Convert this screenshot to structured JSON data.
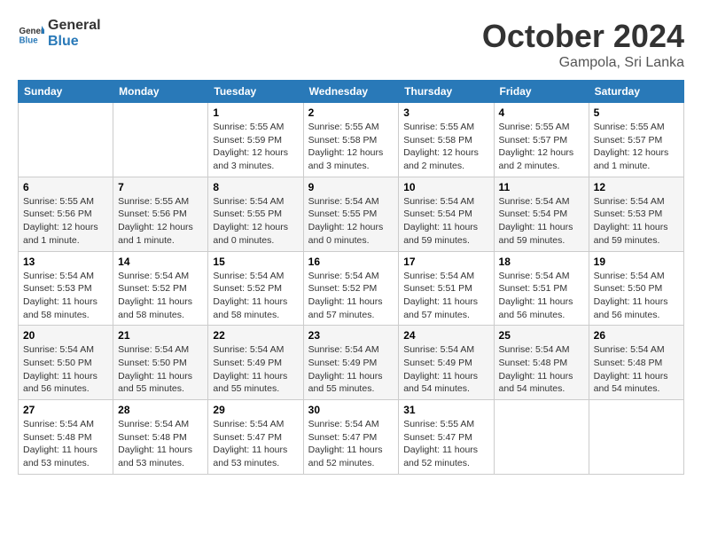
{
  "header": {
    "logo_general": "General",
    "logo_blue": "Blue",
    "month": "October 2024",
    "location": "Gampola, Sri Lanka"
  },
  "days_of_week": [
    "Sunday",
    "Monday",
    "Tuesday",
    "Wednesday",
    "Thursday",
    "Friday",
    "Saturday"
  ],
  "weeks": [
    [
      {
        "day": "",
        "content": ""
      },
      {
        "day": "",
        "content": ""
      },
      {
        "day": "1",
        "content": "Sunrise: 5:55 AM\nSunset: 5:59 PM\nDaylight: 12 hours and 3 minutes."
      },
      {
        "day": "2",
        "content": "Sunrise: 5:55 AM\nSunset: 5:58 PM\nDaylight: 12 hours and 3 minutes."
      },
      {
        "day": "3",
        "content": "Sunrise: 5:55 AM\nSunset: 5:58 PM\nDaylight: 12 hours and 2 minutes."
      },
      {
        "day": "4",
        "content": "Sunrise: 5:55 AM\nSunset: 5:57 PM\nDaylight: 12 hours and 2 minutes."
      },
      {
        "day": "5",
        "content": "Sunrise: 5:55 AM\nSunset: 5:57 PM\nDaylight: 12 hours and 1 minute."
      }
    ],
    [
      {
        "day": "6",
        "content": "Sunrise: 5:55 AM\nSunset: 5:56 PM\nDaylight: 12 hours and 1 minute."
      },
      {
        "day": "7",
        "content": "Sunrise: 5:55 AM\nSunset: 5:56 PM\nDaylight: 12 hours and 1 minute."
      },
      {
        "day": "8",
        "content": "Sunrise: 5:54 AM\nSunset: 5:55 PM\nDaylight: 12 hours and 0 minutes."
      },
      {
        "day": "9",
        "content": "Sunrise: 5:54 AM\nSunset: 5:55 PM\nDaylight: 12 hours and 0 minutes."
      },
      {
        "day": "10",
        "content": "Sunrise: 5:54 AM\nSunset: 5:54 PM\nDaylight: 11 hours and 59 minutes."
      },
      {
        "day": "11",
        "content": "Sunrise: 5:54 AM\nSunset: 5:54 PM\nDaylight: 11 hours and 59 minutes."
      },
      {
        "day": "12",
        "content": "Sunrise: 5:54 AM\nSunset: 5:53 PM\nDaylight: 11 hours and 59 minutes."
      }
    ],
    [
      {
        "day": "13",
        "content": "Sunrise: 5:54 AM\nSunset: 5:53 PM\nDaylight: 11 hours and 58 minutes."
      },
      {
        "day": "14",
        "content": "Sunrise: 5:54 AM\nSunset: 5:52 PM\nDaylight: 11 hours and 58 minutes."
      },
      {
        "day": "15",
        "content": "Sunrise: 5:54 AM\nSunset: 5:52 PM\nDaylight: 11 hours and 58 minutes."
      },
      {
        "day": "16",
        "content": "Sunrise: 5:54 AM\nSunset: 5:52 PM\nDaylight: 11 hours and 57 minutes."
      },
      {
        "day": "17",
        "content": "Sunrise: 5:54 AM\nSunset: 5:51 PM\nDaylight: 11 hours and 57 minutes."
      },
      {
        "day": "18",
        "content": "Sunrise: 5:54 AM\nSunset: 5:51 PM\nDaylight: 11 hours and 56 minutes."
      },
      {
        "day": "19",
        "content": "Sunrise: 5:54 AM\nSunset: 5:50 PM\nDaylight: 11 hours and 56 minutes."
      }
    ],
    [
      {
        "day": "20",
        "content": "Sunrise: 5:54 AM\nSunset: 5:50 PM\nDaylight: 11 hours and 56 minutes."
      },
      {
        "day": "21",
        "content": "Sunrise: 5:54 AM\nSunset: 5:50 PM\nDaylight: 11 hours and 55 minutes."
      },
      {
        "day": "22",
        "content": "Sunrise: 5:54 AM\nSunset: 5:49 PM\nDaylight: 11 hours and 55 minutes."
      },
      {
        "day": "23",
        "content": "Sunrise: 5:54 AM\nSunset: 5:49 PM\nDaylight: 11 hours and 55 minutes."
      },
      {
        "day": "24",
        "content": "Sunrise: 5:54 AM\nSunset: 5:49 PM\nDaylight: 11 hours and 54 minutes."
      },
      {
        "day": "25",
        "content": "Sunrise: 5:54 AM\nSunset: 5:48 PM\nDaylight: 11 hours and 54 minutes."
      },
      {
        "day": "26",
        "content": "Sunrise: 5:54 AM\nSunset: 5:48 PM\nDaylight: 11 hours and 54 minutes."
      }
    ],
    [
      {
        "day": "27",
        "content": "Sunrise: 5:54 AM\nSunset: 5:48 PM\nDaylight: 11 hours and 53 minutes."
      },
      {
        "day": "28",
        "content": "Sunrise: 5:54 AM\nSunset: 5:48 PM\nDaylight: 11 hours and 53 minutes."
      },
      {
        "day": "29",
        "content": "Sunrise: 5:54 AM\nSunset: 5:47 PM\nDaylight: 11 hours and 53 minutes."
      },
      {
        "day": "30",
        "content": "Sunrise: 5:54 AM\nSunset: 5:47 PM\nDaylight: 11 hours and 52 minutes."
      },
      {
        "day": "31",
        "content": "Sunrise: 5:55 AM\nSunset: 5:47 PM\nDaylight: 11 hours and 52 minutes."
      },
      {
        "day": "",
        "content": ""
      },
      {
        "day": "",
        "content": ""
      }
    ]
  ]
}
